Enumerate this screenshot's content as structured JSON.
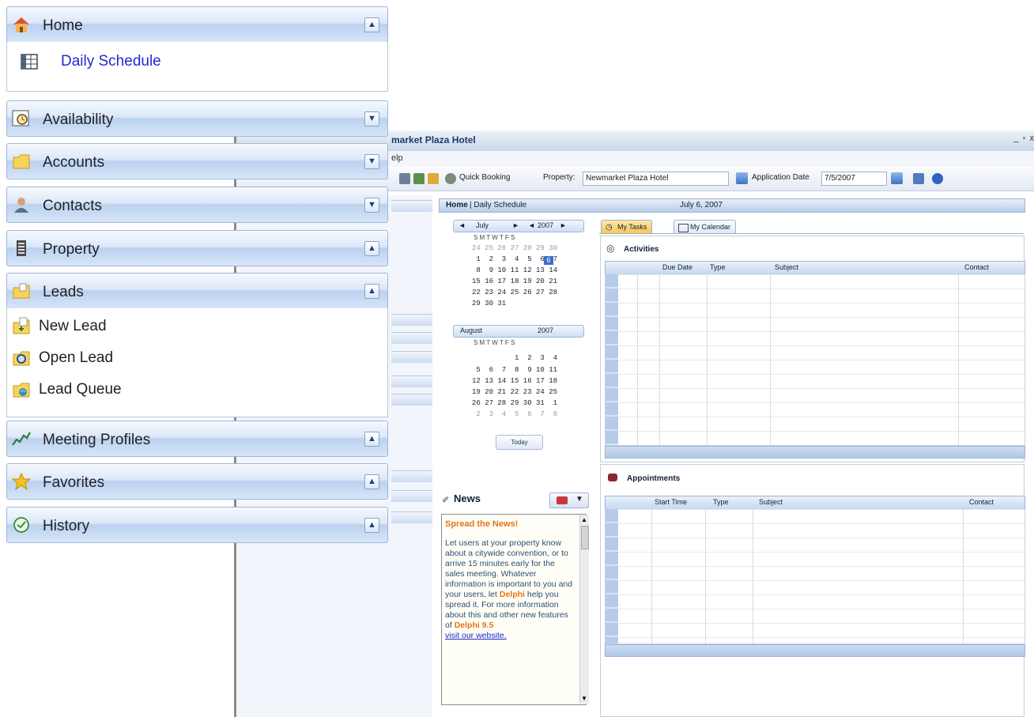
{
  "app": {
    "title": "market Plaza Hotel",
    "window_controls": "_ ▫ x",
    "menu": "elp",
    "toolbar": {
      "quick_booking": "Quick Booking",
      "property_label": "Property:",
      "property_value": "Newmarket Plaza Hotel",
      "app_date_label": "Application Date",
      "app_date_value": "7/5/2007"
    },
    "breadcrumb": {
      "home": "Home",
      "page": "| Daily Schedule",
      "date": "July 6, 2007"
    },
    "calendar1": {
      "month": "July",
      "year": "2007",
      "dow": "S  M  T  W  T  F  S",
      "weeks": [
        "24 25 26 27 28 29 30",
        " 1  2  3  4  5  6  7",
        " 8  9 10 11 12 13 14",
        "15 16 17 18 19 20 21",
        "22 23 24 25 26 27 28",
        "29 30 31"
      ],
      "selected": "6"
    },
    "calendar2": {
      "month": "August",
      "year": "2007",
      "dow": "S  M  T  W  T  F  S",
      "weeks": [
        "          1  2  3  4",
        " 5  6  7  8  9 10 11",
        "12 13 14 15 16 17 18",
        "19 20 21 22 23 24 25",
        "26 27 28 29 30 31  1",
        " 2  3  4  5  6  7  8"
      ]
    },
    "today_button": "Today",
    "news": {
      "title": "News",
      "headline": "Spread the News!",
      "text1": "Let users at your property know about a citywide convention, or to arrive 15 minutes early for the sales meeting. Whatever information is important to you and your users, let ",
      "brand": "Delphi",
      "text2": " help you spread it. For more information about this and other new features of ",
      "brand2": "Delphi 9.5",
      "link": "visit our website."
    },
    "tabs": {
      "tasks": "My Tasks",
      "calendar": "My Calendar"
    },
    "activities": {
      "title": "Activities",
      "columns": [
        "Due Date",
        "Type",
        "Subject",
        "Contact"
      ]
    },
    "appointments": {
      "title": "Appointments",
      "columns": [
        "Start Time",
        "Type",
        "Subject",
        "Contact"
      ]
    }
  },
  "nav": {
    "home": "Home",
    "daily_schedule": "Daily Schedule",
    "availability": "Availability",
    "accounts": "Accounts",
    "contacts": "Contacts",
    "property": "Property",
    "leads": "Leads",
    "new_lead": "New Lead",
    "open_lead": "Open Lead",
    "lead_queue": "Lead Queue",
    "meeting_profiles": "Meeting Profiles",
    "favorites": "Favorites",
    "history": "History",
    "collapse_glyph": "▲",
    "expand_glyph": "▼"
  },
  "colors": {
    "link_blue": "#1f2bd0",
    "accent_orange": "#e4731a",
    "header_blue": "#bad1f0"
  }
}
